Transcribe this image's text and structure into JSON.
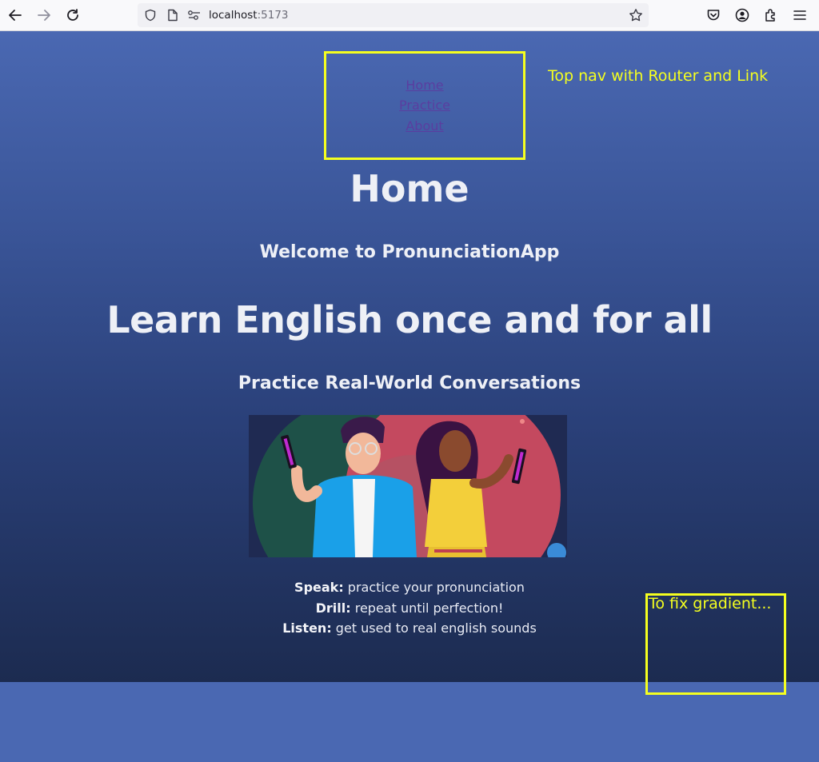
{
  "browser": {
    "url_host": "localhost",
    "url_port": ":5173"
  },
  "nav": {
    "links": [
      "Home",
      "Practice",
      "About"
    ],
    "annotation": "Top nav with Router and Link"
  },
  "main": {
    "page_title": "Home",
    "welcome": "Welcome to PronunciationApp",
    "headline": "Learn English once and for all",
    "subheadline": "Practice Real-World Conversations",
    "hero_image": "illustration of two people holding phones",
    "features": [
      {
        "label": "Speak:",
        "text": " practice your pronunciation"
      },
      {
        "label": "Drill:",
        "text": " repeat until perfection!"
      },
      {
        "label": "Listen:",
        "text": " get used to real english sounds"
      }
    ]
  },
  "annotations": {
    "gradient_note": "To fix gradient..."
  },
  "colors": {
    "annotation": "#f5ff1f",
    "background": "#4a68b2",
    "link": "#5a3ea0"
  }
}
